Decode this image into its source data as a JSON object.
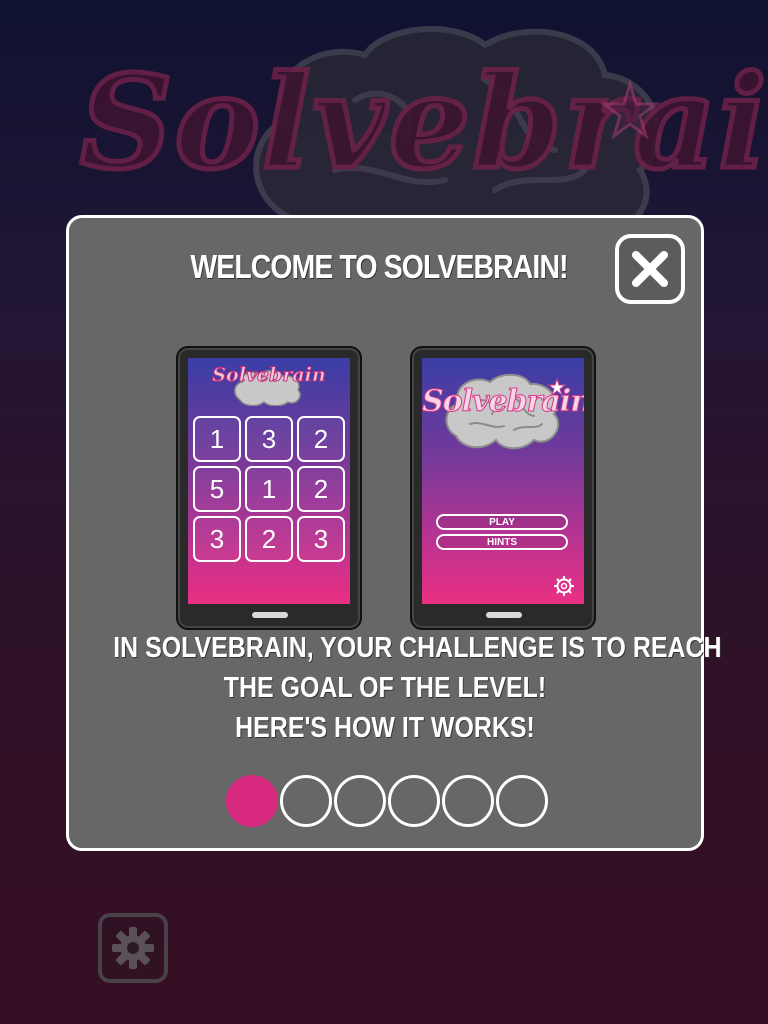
{
  "background": {
    "logo_text": "Solvebrain"
  },
  "dialog": {
    "title": "WELCOME TO SOLVEBRAIN!",
    "close_icon": "close-icon",
    "body_lines": [
      "IN SOLVEBRAIN, YOUR CHALLENGE IS TO REACH",
      "THE GOAL OF THE LEVEL!",
      "HERE'S HOW IT WORKS!"
    ],
    "pages_total": 6,
    "current_page": 1
  },
  "preview_game": {
    "logo_text": "Solvebrain",
    "grid": [
      "1",
      "3",
      "2",
      "5",
      "1",
      "2",
      "3",
      "2",
      "3"
    ]
  },
  "preview_menu": {
    "logo_text": "Solvebrain",
    "play_label": "PLAY",
    "hints_label": "HINTS",
    "settings_icon": "gear-icon"
  },
  "settings_button": {
    "icon": "gear-icon"
  },
  "colors": {
    "accent": "#d6287d",
    "dialog_bg": "#676767"
  }
}
